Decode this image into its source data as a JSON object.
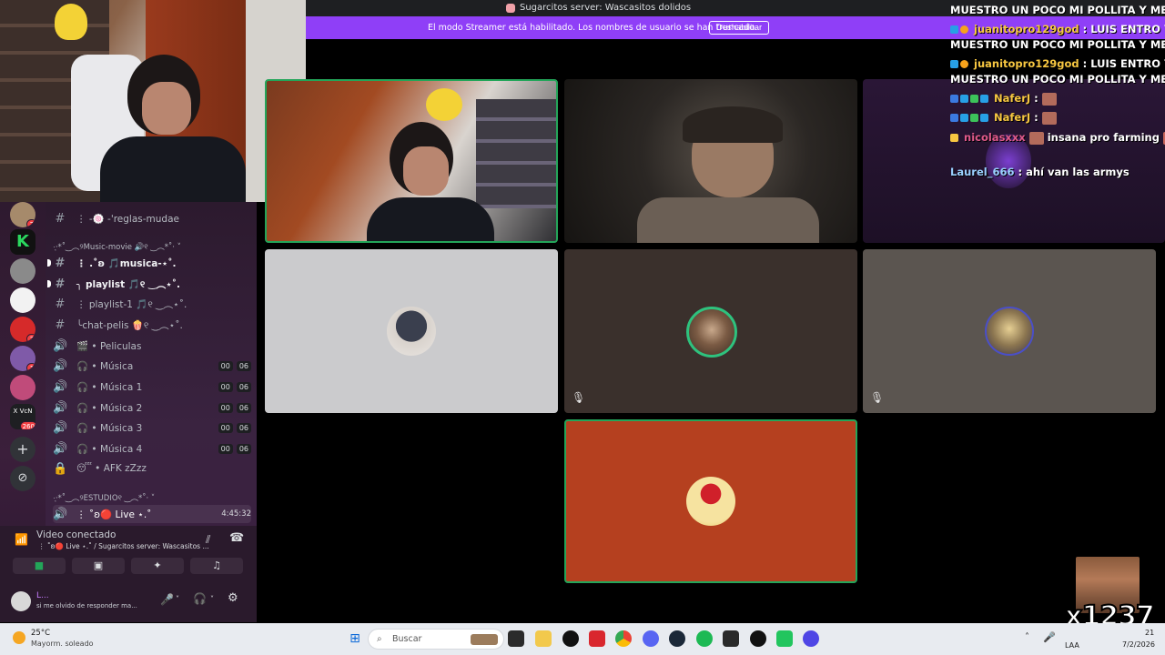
{
  "window": {
    "title": "Sugarcitos server: Wascasitos dolidos",
    "streamer_banner": "El modo Streamer está habilitado. Los nombres de usuario se han truncado.",
    "streamer_button": "Deshabilitar"
  },
  "chat": {
    "lines": [
      {
        "name": "",
        "text": "MUESTRO UN POCO MI POLLITA Y ME SALGO"
      },
      {
        "name": "juanitopro129god",
        "text": ": LUIS ENTRO YO"
      },
      {
        "name": "",
        "text": "MUESTRO UN POCO MI POLLITA Y ME SALGO"
      },
      {
        "name": "juanitopro129god",
        "text": ": LUIS ENTRO YO"
      },
      {
        "name": "",
        "text": "MUESTRO UN POCO MI POLLITA Y ME SALGO"
      },
      {
        "name": "NaferJ",
        "text": ":"
      },
      {
        "name": "NaferJ",
        "text": ":"
      },
      {
        "name": "nicolasxxx",
        "text": "insana pro farming"
      },
      {
        "name": "Laurel_666",
        "text": ": ahí van las armys"
      }
    ]
  },
  "servers": [
    {
      "badge": "2"
    },
    {
      "badge": ""
    },
    {
      "badge": ""
    },
    {
      "badge": ""
    },
    {
      "badge": "3"
    },
    {
      "badge": "1"
    },
    {
      "badge": ""
    },
    {
      "badge": "260",
      "label": "X VcN"
    }
  ],
  "channels": {
    "items": [
      {
        "label": "⋮ -🍥 -'reglas-mudae",
        "type": "text"
      },
      {
        "label": "·͙·*˚‿︵୨Music-movie 🔊୧ ‿︵*˚· ˅",
        "type": "category"
      },
      {
        "label": "⋮ .˚ʚ 🎵musica-⋆˚.",
        "type": "text"
      },
      {
        "label": "╮ playlist 🎵୧ ‿︵⋆˚.",
        "type": "text"
      },
      {
        "label": "⋮ playlist-1 🎵୧ ‿︵⋆˚.",
        "type": "text"
      },
      {
        "label": "╰chat-pelis 🍿୧ ‿︵⋆˚.",
        "type": "text"
      },
      {
        "label": "🎬 • Peliculas",
        "type": "voice"
      },
      {
        "label": "🎧 • Música",
        "type": "voice",
        "count": [
          "00",
          "06"
        ]
      },
      {
        "label": "🎧 • Música 1",
        "type": "voice",
        "count": [
          "00",
          "06"
        ]
      },
      {
        "label": "🎧 • Música 2",
        "type": "voice",
        "count": [
          "00",
          "06"
        ]
      },
      {
        "label": "🎧 • Música 3",
        "type": "voice",
        "count": [
          "00",
          "06"
        ]
      },
      {
        "label": "🎧 • Música 4",
        "type": "voice",
        "count": [
          "00",
          "06"
        ]
      },
      {
        "label": "😴 • AFK zZzz",
        "type": "locked"
      },
      {
        "label": "·͙·*˚‿︵୨ESTUDIO୧ ‿︵*˚· ˅",
        "type": "category"
      },
      {
        "label": "⋮ ˚ʚ🔴 Live ⋆.˚",
        "type": "live",
        "time": "4:45:32"
      }
    ]
  },
  "voice": {
    "status": "Video conectado",
    "sub": "⋮ ˚ʚ🔴 Live ⋆.˚ / Sugarcitos server: Wascasitos ..."
  },
  "user": {
    "name": "L...",
    "status": "si me olvido de responder ma..."
  },
  "taskbar": {
    "weather_temp": "25°C",
    "weather_desc": "Mayorm. soleado",
    "search_placeholder": "Buscar",
    "lang": "LAA",
    "time": "21",
    "date": "7/2/2026"
  },
  "overlay": {
    "counter": "x1237"
  }
}
